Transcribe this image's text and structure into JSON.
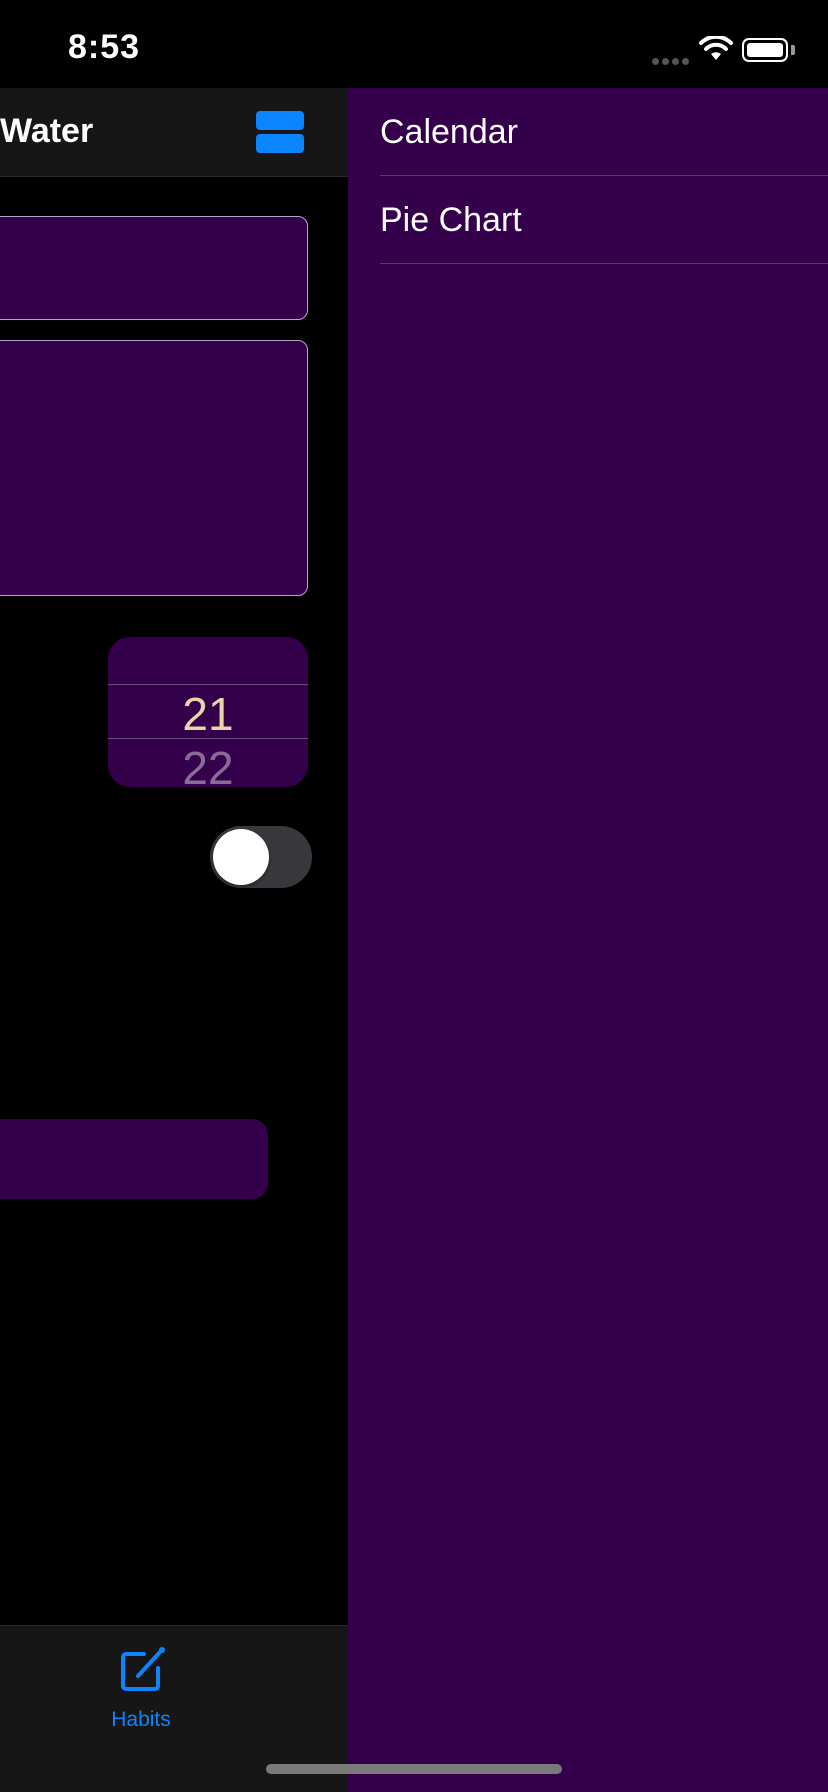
{
  "status_bar": {
    "time": "8:53",
    "icons": [
      "signal-icon",
      "wifi-icon",
      "battery-icon"
    ]
  },
  "nav": {
    "title": "Water",
    "menu_icon": "menu-icon"
  },
  "picker": {
    "selected": "21",
    "next": "22"
  },
  "toggle": {
    "on": false
  },
  "tab_bar": {
    "items": [
      {
        "label": "Habits",
        "icon": "compose-icon",
        "selected": true
      }
    ]
  },
  "drawer": {
    "items": [
      {
        "label": "Calendar"
      },
      {
        "label": "Pie Chart"
      }
    ]
  },
  "colors": {
    "accent": "#0a84ff",
    "panel": "#34004b",
    "picker_text": "#e6d6a8"
  }
}
